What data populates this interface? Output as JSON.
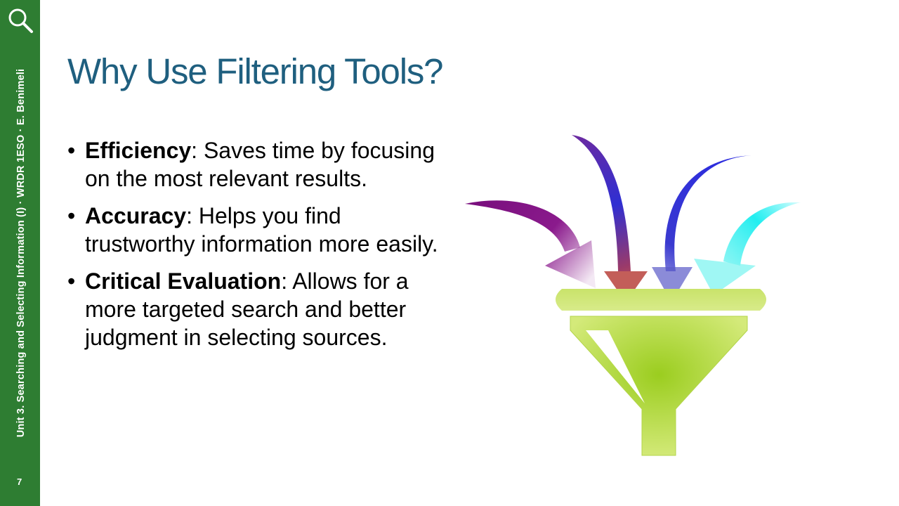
{
  "sidebar": {
    "footer_text": "Unit 3. Searching and Selecting Information (I) · WRDR 1ESO · E. Benimeli",
    "page_number": "7",
    "icon": "search-icon",
    "color": "#2e7d32"
  },
  "slide": {
    "title": "Why Use Filtering Tools?",
    "title_color": "#1f5f7f",
    "bullets": [
      {
        "term": "Efficiency",
        "text": ": Saves time by focusing on the most relevant results."
      },
      {
        "term": "Accuracy",
        "text": ": Helps you find trustworthy information more easily."
      },
      {
        "term": "Critical Evaluation",
        "text": ": Allows for a more targeted search and better judgment in selecting sources."
      }
    ]
  },
  "illustration": {
    "icon": "funnel-icon",
    "arrows": [
      "purple-arrow-icon",
      "violet-blue-arrow-icon",
      "blue-arrow-icon",
      "cyan-arrow-icon"
    ]
  }
}
